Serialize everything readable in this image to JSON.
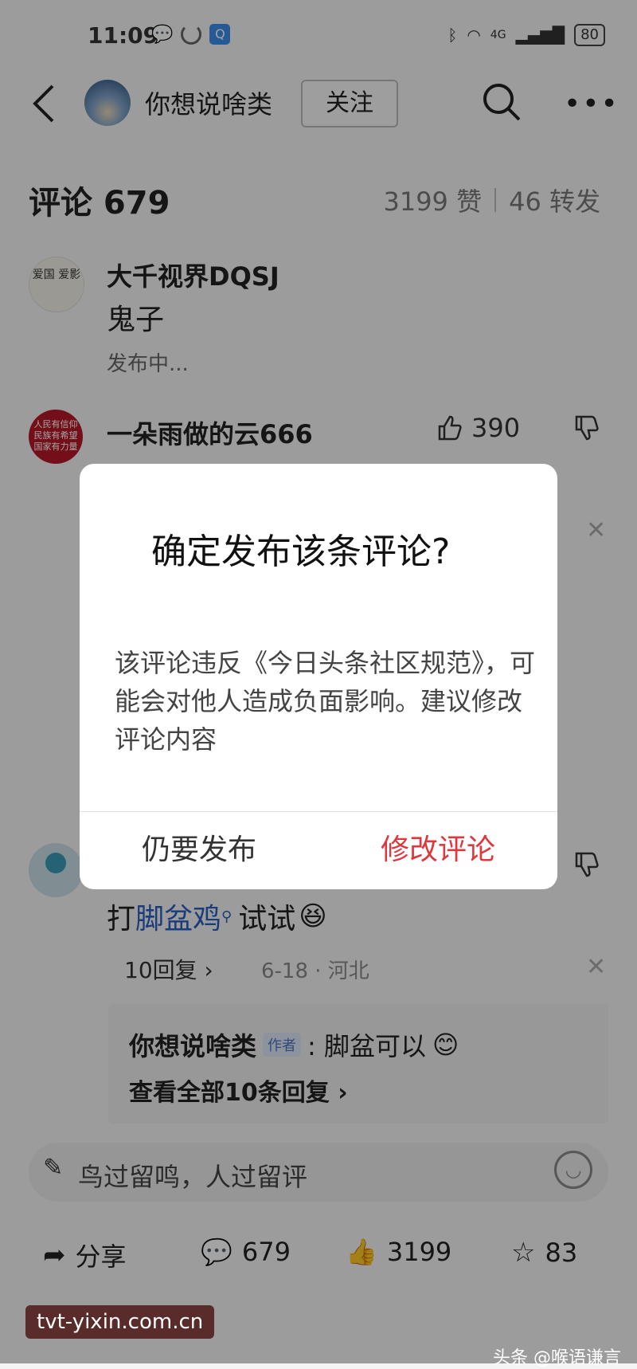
{
  "status": {
    "time": "11:09",
    "net": "4G",
    "battery": "80"
  },
  "header": {
    "author": "你想说啥类",
    "follow": "关注"
  },
  "comments": {
    "title": "评论 679",
    "likes": "3199 赞",
    "shares": "46 转发"
  },
  "c1": {
    "user": "大千视界DQSJ",
    "text": "鬼子",
    "status": "发布中...",
    "avatar_text": "爱国 爱影"
  },
  "c2": {
    "user": "一朵雨做的云666",
    "likes": "390",
    "avatar_text": "人民有信仰 民族有希望 国家有力量"
  },
  "c3": {
    "text_prefix": "打",
    "link": "脚盆鸡",
    "text_suffix": "试试",
    "replies": "10回复",
    "date": "6-18 · 河北"
  },
  "reply": {
    "user": "你想说啥类",
    "tag": "作者",
    "text": ": 脚盆可以",
    "view_all": "查看全部10条回复"
  },
  "input": {
    "placeholder": "鸟过留鸣，人过留评"
  },
  "bottom": {
    "share": "分享",
    "comments": "679",
    "likes": "3199",
    "favs": "83"
  },
  "dialog": {
    "title": "确定发布该条评论?",
    "body": "该评论违反《今日头条社区规范》，可能会对他人造成负面影响。建议修改评论内容",
    "cancel": "仍要发布",
    "confirm": "修改评论",
    "confirm_color": "#e0373e"
  },
  "watermark": {
    "left": "tvt-yixin.com.cn",
    "right": "头条 @喉语谦言"
  }
}
